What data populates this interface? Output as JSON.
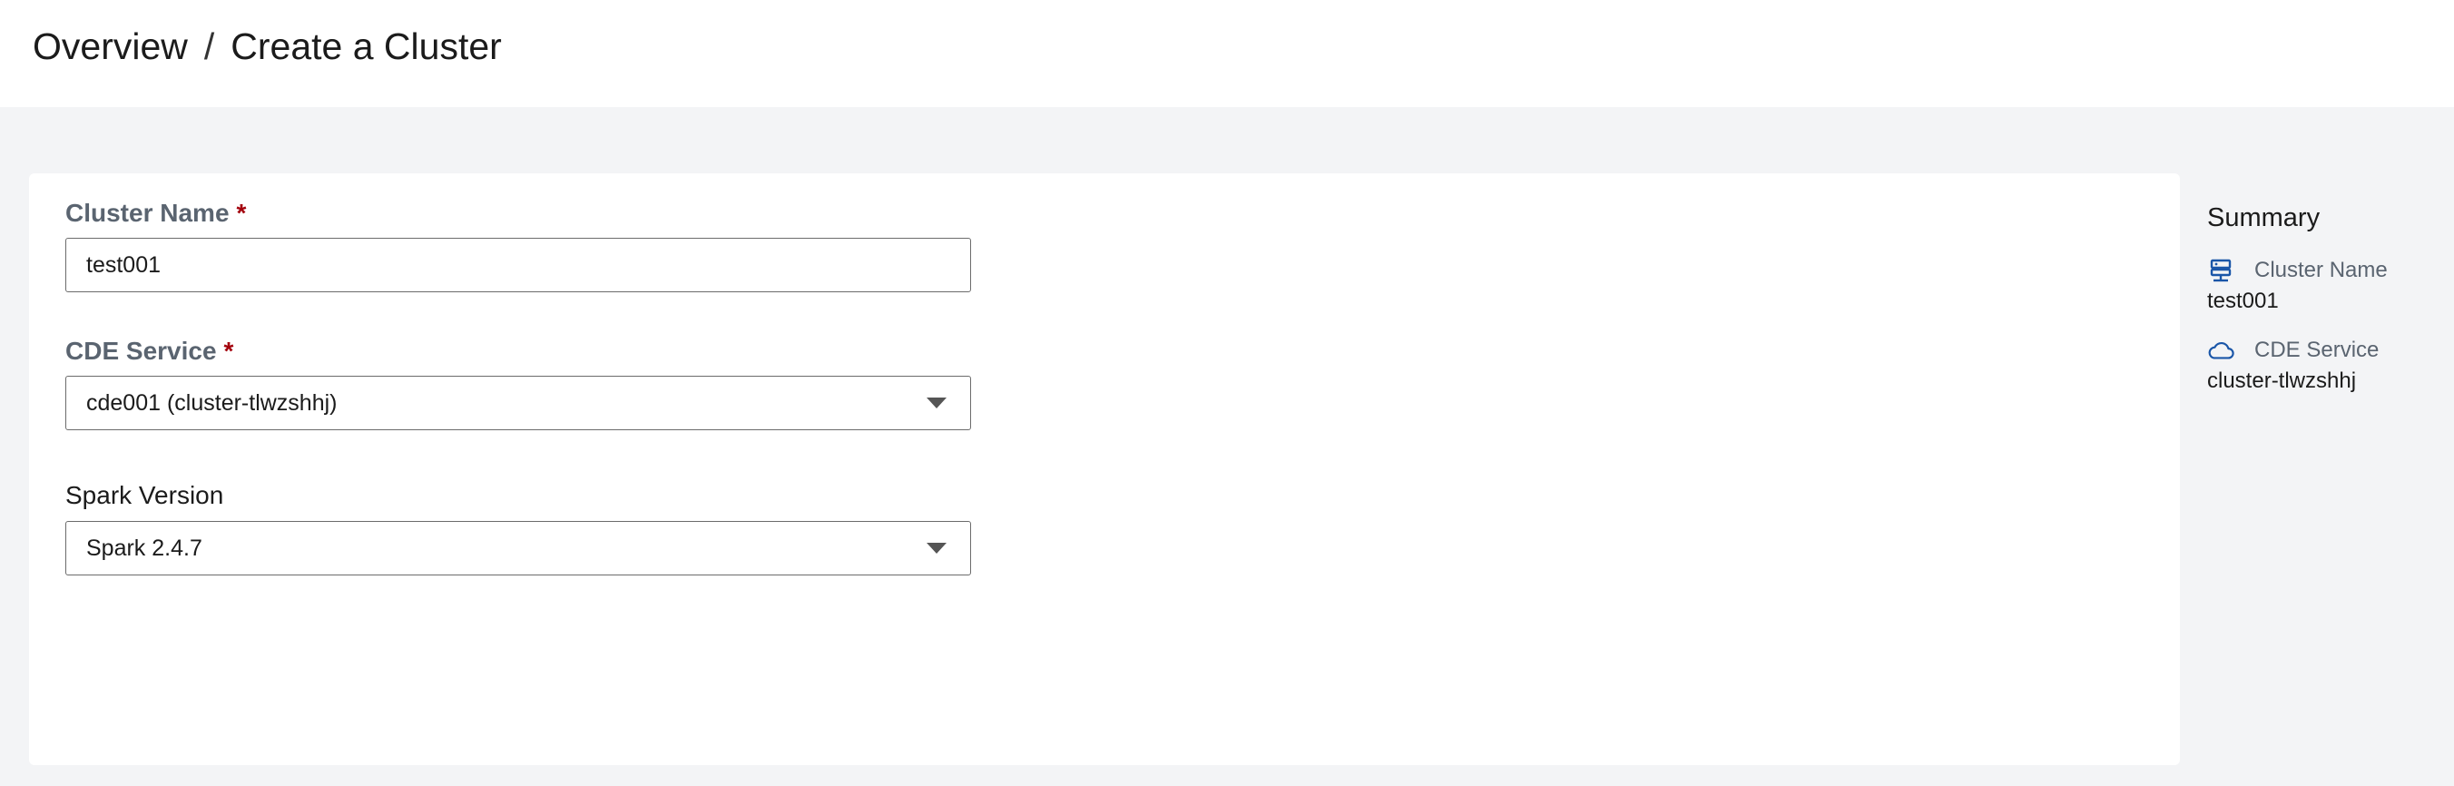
{
  "breadcrumb": {
    "overview": "Overview",
    "separator": "/",
    "current": "Create a Cluster"
  },
  "form": {
    "cluster_name": {
      "label": "Cluster Name",
      "required_mark": "*",
      "value": "test001"
    },
    "cde_service": {
      "label": "CDE Service",
      "required_mark": "*",
      "selected": "cde001 (cluster-tlwzshhj)"
    },
    "spark_version": {
      "label": "Spark Version",
      "selected": "Spark 2.4.7"
    }
  },
  "summary": {
    "title": "Summary",
    "items": [
      {
        "icon": "server-icon",
        "label": "Cluster Name",
        "value": "test001"
      },
      {
        "icon": "cloud-icon",
        "label": "CDE Service",
        "value": "cluster-tlwzshhj"
      }
    ]
  },
  "colors": {
    "required": "#a3000b",
    "icon": "#1a56a8",
    "page_background": "#f3f4f6"
  }
}
